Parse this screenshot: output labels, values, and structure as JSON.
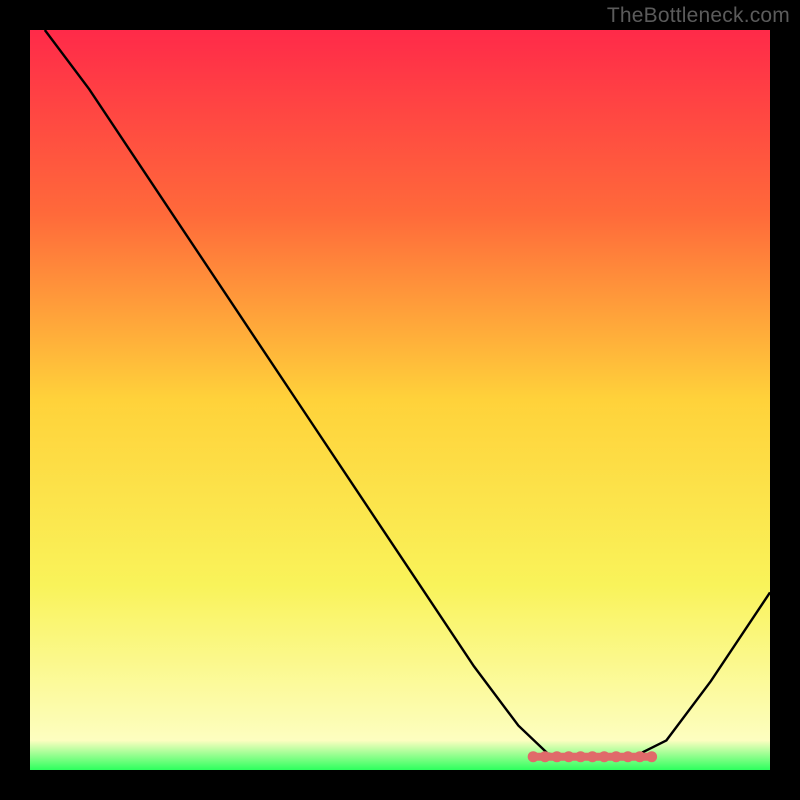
{
  "watermark": "TheBottleneck.com",
  "chart_data": {
    "type": "line",
    "title": "",
    "xlabel": "",
    "ylabel": "",
    "x_range": [
      0,
      100
    ],
    "y_range": [
      0,
      100
    ],
    "background_gradient": {
      "stops": [
        {
          "offset": 0,
          "color": "#ff2a49"
        },
        {
          "offset": 25,
          "color": "#ff6a3a"
        },
        {
          "offset": 50,
          "color": "#ffd23a"
        },
        {
          "offset": 75,
          "color": "#f9f35a"
        },
        {
          "offset": 96,
          "color": "#fdfec0"
        },
        {
          "offset": 100,
          "color": "#2dff5e"
        }
      ]
    },
    "series": [
      {
        "name": "bottleneck-curve",
        "color": "#000000",
        "points": [
          {
            "x": 2,
            "y": 100
          },
          {
            "x": 8,
            "y": 92
          },
          {
            "x": 14,
            "y": 83
          },
          {
            "x": 20,
            "y": 74
          },
          {
            "x": 28,
            "y": 62
          },
          {
            "x": 36,
            "y": 50
          },
          {
            "x": 44,
            "y": 38
          },
          {
            "x": 52,
            "y": 26
          },
          {
            "x": 60,
            "y": 14
          },
          {
            "x": 66,
            "y": 6
          },
          {
            "x": 70,
            "y": 2.2
          },
          {
            "x": 74,
            "y": 1.5
          },
          {
            "x": 78,
            "y": 1.5
          },
          {
            "x": 82,
            "y": 2.0
          },
          {
            "x": 86,
            "y": 4
          },
          {
            "x": 92,
            "y": 12
          },
          {
            "x": 100,
            "y": 24
          }
        ]
      }
    ],
    "highlight_band": {
      "name": "optimal-range",
      "color": "#e06a6a",
      "x_start": 68,
      "x_end": 84,
      "y": 1.8
    }
  }
}
